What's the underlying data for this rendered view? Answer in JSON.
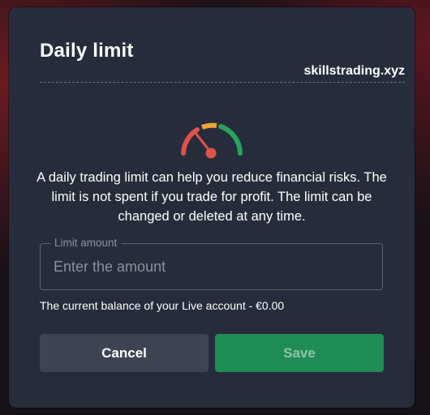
{
  "dialog": {
    "title": "Daily limit",
    "watermark": "skillstrading.xyz",
    "description": "A daily trading limit can help you reduce financial risks. The limit is not spent if you trade for profit. The limit can be changed or deleted at any time.",
    "gauge_icon": "speedometer-gauge-icon",
    "field": {
      "label": "Limit amount",
      "placeholder": "Enter the amount",
      "value": ""
    },
    "balance_text": "The current balance of your Live account - €0.00",
    "buttons": {
      "cancel_label": "Cancel",
      "save_label": "Save"
    },
    "colors": {
      "background": "#262c3b",
      "save_button": "#1f8c54",
      "cancel_button": "#3d4353",
      "gauge_red": "#e0524a",
      "gauge_orange": "#f0a23a",
      "gauge_green": "#27a35d"
    }
  }
}
